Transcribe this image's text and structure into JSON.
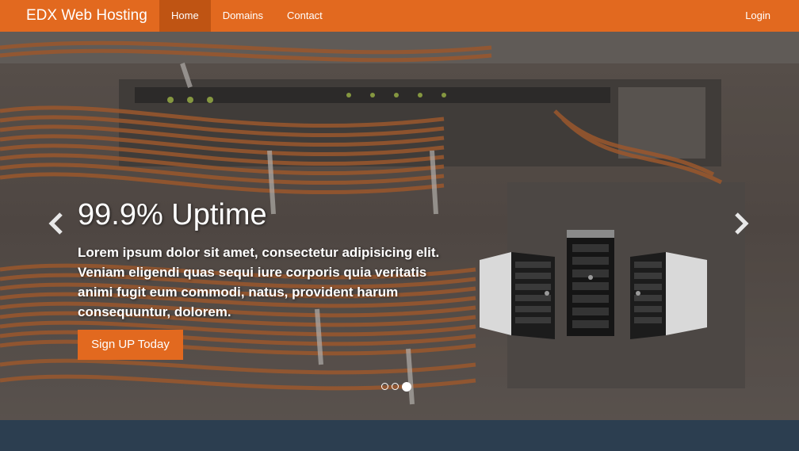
{
  "navbar": {
    "brand": "EDX Web Hosting",
    "items": [
      {
        "label": "Home",
        "active": true
      },
      {
        "label": "Domains",
        "active": false
      },
      {
        "label": "Contact",
        "active": false
      }
    ],
    "login_label": "Login",
    "accent_color": "#e2691f"
  },
  "hero": {
    "headline": "99.9% Uptime",
    "lead": "Lorem ipsum dolor sit amet, consectetur adipisicing elit. Veniam eligendi quas sequi iure corporis quia veritatis animi fugit eum commodi, natus, provident harum consequuntur, dolorem.",
    "cta_label": "Sign UP Today",
    "prev_icon": "chevron-left-icon",
    "next_icon": "chevron-right-icon",
    "slides_total": 3,
    "active_slide": 3
  },
  "footer": {
    "band_color": "#2c3e50"
  }
}
